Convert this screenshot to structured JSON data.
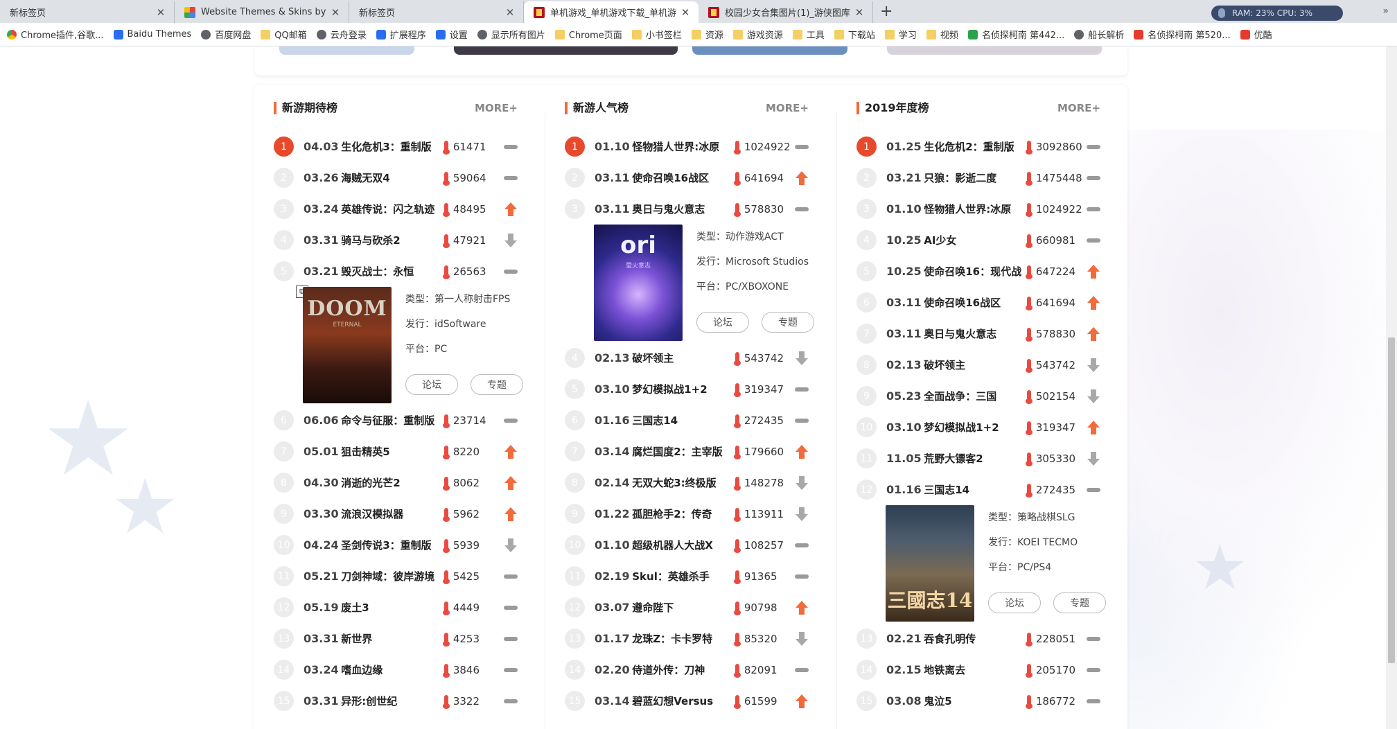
{
  "tabs": [
    {
      "label": "新标签页",
      "icon": "none",
      "active": false
    },
    {
      "label": "Website Themes & Skins by",
      "icon": "theme",
      "active": false
    },
    {
      "label": "新标签页",
      "icon": "none",
      "active": false
    },
    {
      "label": "单机游戏_单机游戏下载_单机游",
      "icon": "game",
      "active": true
    },
    {
      "label": "校园少女合集图片(1)_游侠图库",
      "icon": "game",
      "active": false
    }
  ],
  "newtab_label": "+",
  "sysmon": "RAM: 23%  CPU: 3%",
  "bookmarks": [
    {
      "label": "Chrome插件,谷歌...",
      "icon": "chrome"
    },
    {
      "label": "Baidu Themes",
      "icon": "blue"
    },
    {
      "label": "百度网盘",
      "icon": "circle"
    },
    {
      "label": "QQ邮箱",
      "icon": "folder"
    },
    {
      "label": "云舟登录",
      "icon": "circle"
    },
    {
      "label": "扩展程序",
      "icon": "blue"
    },
    {
      "label": "设置",
      "icon": "blue"
    },
    {
      "label": "显示所有图片",
      "icon": "circle"
    },
    {
      "label": "Chrome页面",
      "icon": "folder"
    },
    {
      "label": "小书签栏",
      "icon": "folder"
    },
    {
      "label": "资源",
      "icon": "folder"
    },
    {
      "label": "游戏资源",
      "icon": "folder"
    },
    {
      "label": "工具",
      "icon": "folder"
    },
    {
      "label": "下载站",
      "icon": "folder"
    },
    {
      "label": "学习",
      "icon": "folder"
    },
    {
      "label": "视频",
      "icon": "folder"
    },
    {
      "label": "名侦探柯南 第442...",
      "icon": "green"
    },
    {
      "label": "船长解析",
      "icon": "circle"
    },
    {
      "label": "名侦探柯南 第520...",
      "icon": "red"
    },
    {
      "label": "优酷",
      "icon": "red"
    }
  ],
  "bookmarks_more": "»",
  "columns": [
    {
      "title": "新游期待榜",
      "more": "MORE+",
      "detail_after": 5,
      "detail": {
        "type_label": "类型：",
        "type": "第一人称射击FPS",
        "pub_label": "发行：",
        "pub": "idSoftware",
        "plat_label": "平台：",
        "plat": "PC",
        "btn1": "论坛",
        "btn2": "专题",
        "cover": "doom",
        "cover_title": "DOOM",
        "cover_sub": "ETERNAL"
      },
      "rows": [
        {
          "n": "1",
          "date": "04.03",
          "name": "生化危机3：重制版",
          "heat": "61471",
          "trend": "flat"
        },
        {
          "n": "2",
          "date": "03.26",
          "name": "海贼无双4",
          "heat": "59064",
          "trend": "flat"
        },
        {
          "n": "3",
          "date": "03.24",
          "name": "英雄传说：闪之轨迹",
          "heat": "48495",
          "trend": "up"
        },
        {
          "n": "4",
          "date": "03.31",
          "name": "骑马与砍杀2",
          "heat": "47921",
          "trend": "down"
        },
        {
          "n": "5",
          "date": "03.21",
          "name": "毁灭战士：永恒",
          "heat": "26563",
          "trend": "flat"
        },
        {
          "n": "6",
          "date": "06.06",
          "name": "命令与征服：重制版",
          "heat": "23714",
          "trend": "flat"
        },
        {
          "n": "7",
          "date": "05.01",
          "name": "狙击精英5",
          "heat": "8220",
          "trend": "up"
        },
        {
          "n": "8",
          "date": "04.30",
          "name": "消逝的光芒2",
          "heat": "8062",
          "trend": "up"
        },
        {
          "n": "9",
          "date": "03.30",
          "name": "流浪汉模拟器",
          "heat": "5962",
          "trend": "up"
        },
        {
          "n": "10",
          "date": "04.24",
          "name": "圣剑传说3：重制版",
          "heat": "5939",
          "trend": "down"
        },
        {
          "n": "11",
          "date": "05.21",
          "name": "刀剑神域：彼岸游境",
          "heat": "5425",
          "trend": "flat"
        },
        {
          "n": "12",
          "date": "05.19",
          "name": "废土3",
          "heat": "4449",
          "trend": "flat"
        },
        {
          "n": "13",
          "date": "03.31",
          "name": "新世界",
          "heat": "4253",
          "trend": "flat"
        },
        {
          "n": "14",
          "date": "03.24",
          "name": "嗜血边缘",
          "heat": "3846",
          "trend": "flat"
        },
        {
          "n": "15",
          "date": "03.31",
          "name": "异形:创世纪",
          "heat": "3322",
          "trend": "flat"
        }
      ]
    },
    {
      "title": "新游人气榜",
      "more": "MORE+",
      "detail_after": 3,
      "detail": {
        "type_label": "类型：",
        "type": "动作游戏ACT",
        "pub_label": "发行：",
        "pub": "Microsoft Studios",
        "plat_label": "平台：",
        "plat": "PC/XBOXONE",
        "btn1": "论坛",
        "btn2": "专题",
        "cover": "ori",
        "cover_title": "ori",
        "cover_sub": "萤火意志"
      },
      "rows": [
        {
          "n": "1",
          "date": "01.10",
          "name": "怪物猎人世界:冰原",
          "heat": "1024922",
          "trend": "flat"
        },
        {
          "n": "2",
          "date": "03.11",
          "name": "使命召唤16战区",
          "heat": "641694",
          "trend": "up"
        },
        {
          "n": "3",
          "date": "03.11",
          "name": "奥日与鬼火意志",
          "heat": "578830",
          "trend": "flat"
        },
        {
          "n": "4",
          "date": "02.13",
          "name": "破坏领主",
          "heat": "543742",
          "trend": "down"
        },
        {
          "n": "5",
          "date": "03.10",
          "name": "梦幻模拟战1+2",
          "heat": "319347",
          "trend": "flat"
        },
        {
          "n": "6",
          "date": "01.16",
          "name": "三国志14",
          "heat": "272435",
          "trend": "flat"
        },
        {
          "n": "7",
          "date": "03.14",
          "name": "腐烂国度2：主宰版",
          "heat": "179660",
          "trend": "up"
        },
        {
          "n": "8",
          "date": "02.14",
          "name": "无双大蛇3:终极版",
          "heat": "148278",
          "trend": "down"
        },
        {
          "n": "9",
          "date": "01.22",
          "name": "孤胆枪手2：传奇",
          "heat": "113911",
          "trend": "down"
        },
        {
          "n": "10",
          "date": "01.10",
          "name": "超级机器人大战X",
          "heat": "108257",
          "trend": "flat"
        },
        {
          "n": "11",
          "date": "02.19",
          "name": "Skul：英雄杀手",
          "heat": "91365",
          "trend": "flat"
        },
        {
          "n": "12",
          "date": "03.07",
          "name": "遵命陛下",
          "heat": "90798",
          "trend": "up"
        },
        {
          "n": "13",
          "date": "01.17",
          "name": "龙珠Z：卡卡罗特",
          "heat": "85320",
          "trend": "down"
        },
        {
          "n": "14",
          "date": "02.20",
          "name": "侍道外传：刀神",
          "heat": "82091",
          "trend": "flat"
        },
        {
          "n": "15",
          "date": "03.14",
          "name": "碧蓝幻想Versus",
          "heat": "61599",
          "trend": "up"
        }
      ]
    },
    {
      "title": "2019年度榜",
      "more": "MORE+",
      "detail_after": 12,
      "detail": {
        "type_label": "类型：",
        "type": "策略战棋SLG",
        "pub_label": "发行：",
        "pub": "KOEI TECMO",
        "plat_label": "平台：",
        "plat": "PC/PS4",
        "btn1": "论坛",
        "btn2": "专题",
        "cover": "sgz",
        "cover_title": "三國志14",
        "cover_sub": ""
      },
      "rows": [
        {
          "n": "1",
          "date": "01.25",
          "name": "生化危机2：重制版",
          "heat": "3092860",
          "trend": "flat"
        },
        {
          "n": "2",
          "date": "03.21",
          "name": "只狼：影逝二度",
          "heat": "1475448",
          "trend": "flat"
        },
        {
          "n": "3",
          "date": "01.10",
          "name": "怪物猎人世界:冰原",
          "heat": "1024922",
          "trend": "flat"
        },
        {
          "n": "4",
          "date": "10.25",
          "name": "AI少女",
          "heat": "660981",
          "trend": "flat"
        },
        {
          "n": "5",
          "date": "10.25",
          "name": "使命召唤16：现代战",
          "heat": "647224",
          "trend": "up"
        },
        {
          "n": "6",
          "date": "03.11",
          "name": "使命召唤16战区",
          "heat": "641694",
          "trend": "up"
        },
        {
          "n": "7",
          "date": "03.11",
          "name": "奥日与鬼火意志",
          "heat": "578830",
          "trend": "up"
        },
        {
          "n": "8",
          "date": "02.13",
          "name": "破坏领主",
          "heat": "543742",
          "trend": "down"
        },
        {
          "n": "9",
          "date": "05.23",
          "name": "全面战争：三国",
          "heat": "502154",
          "trend": "down"
        },
        {
          "n": "10",
          "date": "03.10",
          "name": "梦幻模拟战1+2",
          "heat": "319347",
          "trend": "up"
        },
        {
          "n": "11",
          "date": "11.05",
          "name": "荒野大镖客2",
          "heat": "305330",
          "trend": "down"
        },
        {
          "n": "12",
          "date": "01.16",
          "name": "三国志14",
          "heat": "272435",
          "trend": "flat"
        },
        {
          "n": "13",
          "date": "02.21",
          "name": "吞食孔明传",
          "heat": "228051",
          "trend": "flat"
        },
        {
          "n": "14",
          "date": "02.15",
          "name": "地铁离去",
          "heat": "205170",
          "trend": "flat"
        },
        {
          "n": "15",
          "date": "03.08",
          "name": "鬼泣5",
          "heat": "186772",
          "trend": "flat"
        }
      ]
    }
  ]
}
